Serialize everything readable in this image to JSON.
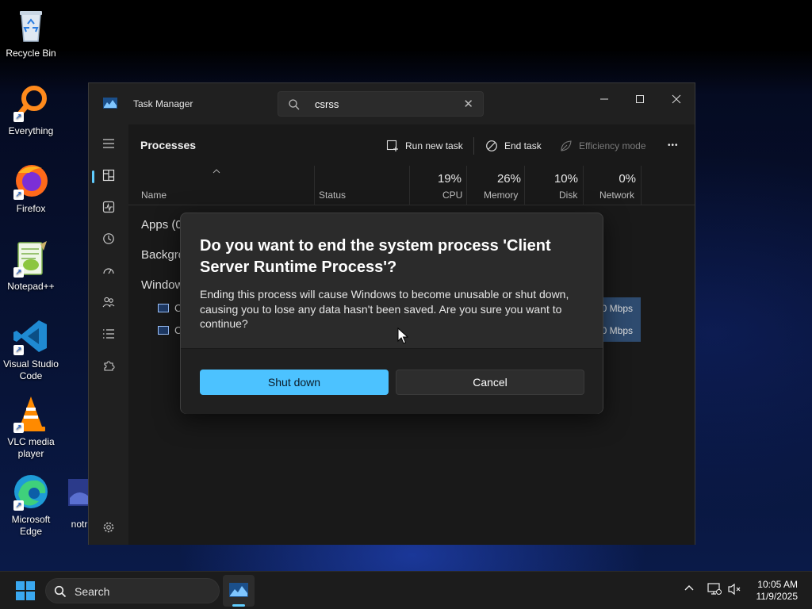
{
  "desktop": {
    "icons": [
      {
        "label": "Recycle Bin",
        "icon": "recycle-bin-icon"
      },
      {
        "label": "Everything",
        "icon": "everything-icon"
      },
      {
        "label": "Firefox",
        "icon": "firefox-icon"
      },
      {
        "label": "Notepad++",
        "icon": "notepad-plus-plus-icon"
      },
      {
        "label": "Visual Studio Code",
        "icon": "vscode-icon"
      },
      {
        "label": "VLC media player",
        "icon": "vlc-icon"
      },
      {
        "label": "Microsoft Edge",
        "icon": "edge-icon"
      },
      {
        "label": "notr",
        "icon": "file-icon"
      }
    ]
  },
  "task_manager": {
    "title": "Task Manager",
    "search": {
      "value": "csrss",
      "clear_glyph": "✕"
    },
    "page_title": "Processes",
    "commands": {
      "run_new_task": "Run new task",
      "end_task": "End task",
      "efficiency_mode": "Efficiency mode",
      "more": "•••"
    },
    "columns": {
      "name": "Name",
      "status": "Status",
      "cpu": {
        "pct": "19%",
        "label": "CPU"
      },
      "memory": {
        "pct": "26%",
        "label": "Memory"
      },
      "disk": {
        "pct": "10%",
        "label": "Disk"
      },
      "network": {
        "pct": "0%",
        "label": "Network"
      }
    },
    "groups": {
      "apps": "Apps (0",
      "background": "Backgro",
      "windows": "Window"
    },
    "rows": [
      {
        "name": "C",
        "network": "0 Mbps"
      },
      {
        "name": "C",
        "network": "0 Mbps"
      }
    ]
  },
  "dialog": {
    "title": "Do you want to end the system process 'Client Server Runtime Process'?",
    "body": "Ending this process will cause Windows to become unusable or shut down, causing you to lose any data hasn't been saved. Are you sure you want to continue?",
    "primary_button": "Shut down",
    "secondary_button": "Cancel"
  },
  "taskbar": {
    "search_label": "Search",
    "time": "10:05 AM",
    "date": "11/9/2025"
  },
  "colors": {
    "accent": "#4cc2ff",
    "nav_indicator": "#60cdff"
  }
}
